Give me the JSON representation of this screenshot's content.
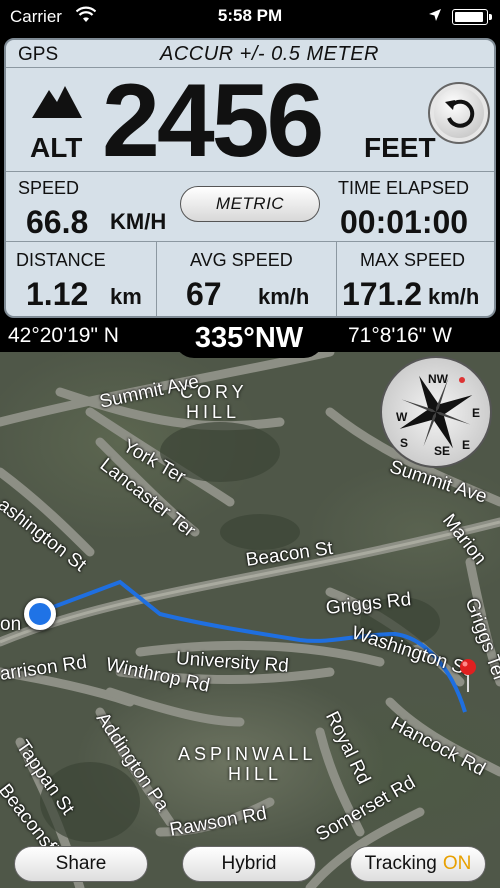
{
  "status_bar": {
    "carrier": "Carrier",
    "time": "5:58 PM"
  },
  "gps": {
    "label": "GPS",
    "accuracy": "ACCUR +/- 0.5 METER",
    "alt_label": "ALT",
    "altitude": "2456",
    "altitude_unit": "FEET"
  },
  "stats": {
    "speed_label": "SPEED",
    "speed_value": "66.8",
    "speed_unit": "KM/H",
    "metric_button": "METRIC",
    "time_label": "TIME ELAPSED",
    "time_value": "00:01:00",
    "distance_label": "DISTANCE",
    "distance_value": "1.12",
    "distance_unit": "km",
    "avg_label": "AVG SPEED",
    "avg_value": "67",
    "avg_unit": "km/h",
    "max_label": "MAX SPEED",
    "max_value": "171.2",
    "max_unit": "km/h"
  },
  "coords": {
    "lat": "42°20'19\" N",
    "heading": "335°NW",
    "lon": "71°8'16\" W"
  },
  "compass": {
    "n": "N",
    "s": "S",
    "e": "E",
    "w": "W",
    "nw": "NW",
    "ne": "NE",
    "sw": "SW",
    "se": "SE"
  },
  "map": {
    "hill_1": "CORY",
    "hill_1b": "HILL",
    "hill_2": "ASPINWALL",
    "hill_2b": "HILL",
    "streets": {
      "summit_ave": "Summit Ave",
      "summit_ave_2": "Summit Ave",
      "york_ter": "York Ter",
      "lancaster_ter": "Lancaster Ter",
      "washington_st": "ashington St",
      "beacon_st": "Beacon St",
      "griggs_rd": "Griggs Rd",
      "washington_st_2": "Washington St",
      "university_rd": "University Rd",
      "winthrop_rd": "Winthrop Rd",
      "harrison_rd": "arrison Rd",
      "addington_pa": "Addington Pa",
      "tappan_st": "Tappan St",
      "beaconsfield": "Beaconsfield",
      "royal_rd": "Royal Rd",
      "hancock_rd": "Hancock Rd",
      "somerset_rd": "Somerset Rd",
      "rawson_rd": "Rawson Rd",
      "marion": "Marion",
      "griggs_ter": "Griggs Ter",
      "on": "on"
    }
  },
  "buttons": {
    "share": "Share",
    "hybrid": "Hybrid",
    "tracking": "Tracking",
    "tracking_state": "ON"
  },
  "colors": {
    "panel": "#d6e0e8",
    "route": "#1f6fe0",
    "accent_on": "#e8a000"
  }
}
